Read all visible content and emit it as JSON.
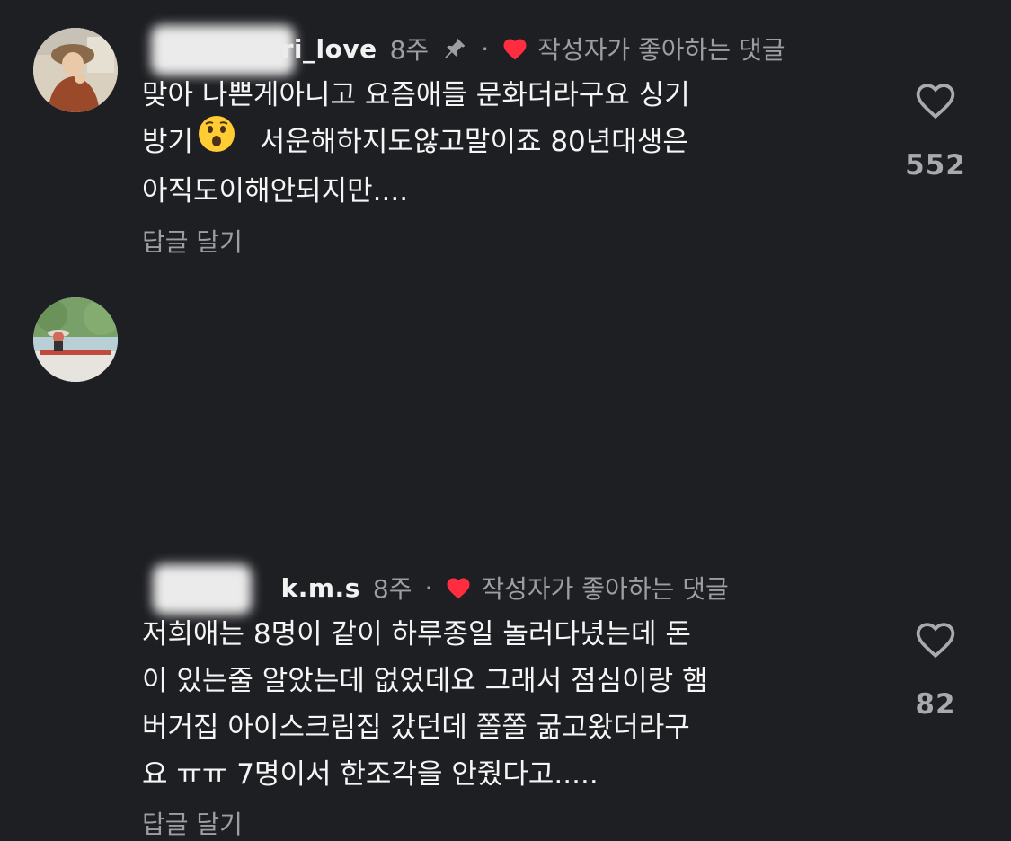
{
  "comments": [
    {
      "username": "ri_love",
      "time": "8주",
      "dot": "·",
      "liked_label": "작성자가 좋아하는 댓글",
      "body_lines": [
        "맞아 나쁜게아니고 요즘애들 문화더라구요 싱기",
        "방기",
        "서운해하지도않고말이죠 80년대생은",
        "아직도이해안되지만...."
      ],
      "reply_label": "답글 달기",
      "like_count": "552"
    },
    {
      "username": "k.m.s",
      "time": "8주",
      "dot": "·",
      "liked_label": "작성자가 좋아하는 댓글",
      "body_lines": [
        "저희애는 8명이 같이 하루종일 놀러다녔는데 돈",
        "이 있는줄 알았는데 없었데요 그래서 점심이랑 햄",
        "버거집  아이스크림집 갔던데  쫄쫄 굶고왔더라구",
        "요 ㅠㅠ 7명이서 한조각을 안줬다고....."
      ],
      "reply_label": "답글 달기",
      "like_count": "82"
    }
  ],
  "colors": {
    "background": "#1e1f23",
    "heart_red": "#ff2d3f",
    "secondary_text": "#9d9ea3"
  },
  "icons": {
    "pin": "pin-icon",
    "heart_small": "heart-filled-icon",
    "like": "heart-outline-icon",
    "emoji": "astonished-face-emoji"
  }
}
